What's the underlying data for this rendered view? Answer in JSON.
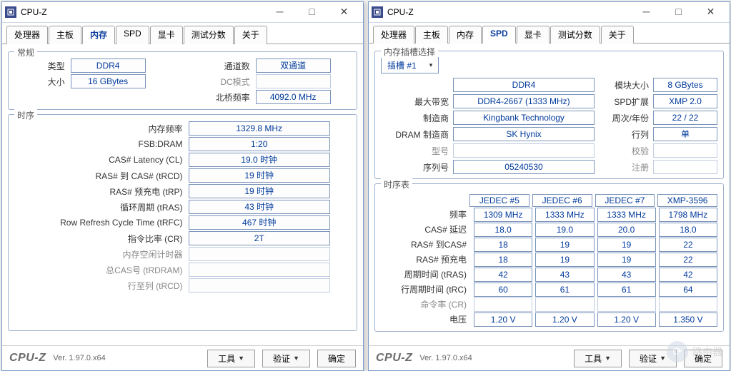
{
  "app_title": "CPU-Z",
  "tabs": [
    "处理器",
    "主板",
    "内存",
    "SPD",
    "显卡",
    "测试分数",
    "关于"
  ],
  "footer": {
    "brand": "CPU-Z",
    "ver": "Ver. 1.97.0.x64",
    "tools": "工具",
    "validate": "验证",
    "ok": "确定"
  },
  "left": {
    "active_tab": 2,
    "general": {
      "title": "常规",
      "type_l": "类型",
      "type": "DDR4",
      "size_l": "大小",
      "size": "16 GBytes",
      "channels_l": "通道数",
      "channels": "双通道",
      "dc_l": "DC模式",
      "nb_l": "北桥频率",
      "nb": "4092.0 MHz"
    },
    "timing": {
      "title": "时序",
      "rows": [
        {
          "l": "内存频率",
          "v": "1329.8 MHz"
        },
        {
          "l": "FSB:DRAM",
          "v": "1:20"
        },
        {
          "l": "CAS# Latency (CL)",
          "v": "19.0 时钟"
        },
        {
          "l": "RAS# 到 CAS# (tRCD)",
          "v": "19 时钟"
        },
        {
          "l": "RAS# 预充电 (tRP)",
          "v": "19 时钟"
        },
        {
          "l": "循环周期 (tRAS)",
          "v": "43 时钟"
        },
        {
          "l": "Row Refresh Cycle Time (tRFC)",
          "v": "467 时钟"
        },
        {
          "l": "指令比率 (CR)",
          "v": "2T"
        }
      ],
      "gray": [
        "内存空闲计时器",
        "总CAS号 (tRDRAM)",
        "行至列 (tRCD)"
      ]
    }
  },
  "right": {
    "active_tab": 3,
    "slot_group": "内存插槽选择",
    "slot_label": "插槽 #1",
    "info": [
      {
        "l": "",
        "v": "DDR4",
        "r": "模块大小",
        "rv": "8 GBytes"
      },
      {
        "l": "最大带宽",
        "v": "DDR4-2667 (1333 MHz)",
        "r": "SPD扩展",
        "rv": "XMP 2.0"
      },
      {
        "l": "制造商",
        "v": "Kingbank Technology",
        "r": "周次/年份",
        "rv": "22 / 22"
      },
      {
        "l": "DRAM 制造商",
        "v": "SK Hynix",
        "r": "行列",
        "rv": "单"
      },
      {
        "l": "型号",
        "v": "",
        "r": "校验",
        "rv": "",
        "gray": true
      },
      {
        "l": "序列号",
        "v": "05240530",
        "r": "注册",
        "rv": "",
        "rg": true
      }
    ],
    "table": {
      "title": "时序表",
      "cols": [
        "JEDEC #5",
        "JEDEC #6",
        "JEDEC #7",
        "XMP-3596"
      ],
      "rows": [
        {
          "l": "频率",
          "c": [
            "1309 MHz",
            "1333 MHz",
            "1333 MHz",
            "1798 MHz"
          ]
        },
        {
          "l": "CAS# 延迟",
          "c": [
            "18.0",
            "19.0",
            "20.0",
            "18.0"
          ]
        },
        {
          "l": "RAS# 到CAS#",
          "c": [
            "18",
            "19",
            "19",
            "22"
          ]
        },
        {
          "l": "RAS# 预充电",
          "c": [
            "18",
            "19",
            "19",
            "22"
          ]
        },
        {
          "l": "周期时间 (tRAS)",
          "c": [
            "42",
            "43",
            "43",
            "42"
          ]
        },
        {
          "l": "行周期时间 (tRC)",
          "c": [
            "60",
            "61",
            "61",
            "64"
          ]
        },
        {
          "l": "命令率 (CR)",
          "c": [
            "",
            "",
            "",
            ""
          ],
          "gray": true
        },
        {
          "l": "电压",
          "c": [
            "1.20 V",
            "1.20 V",
            "1.20 V",
            "1.350 V"
          ]
        }
      ]
    }
  },
  "watermark": "路由器"
}
